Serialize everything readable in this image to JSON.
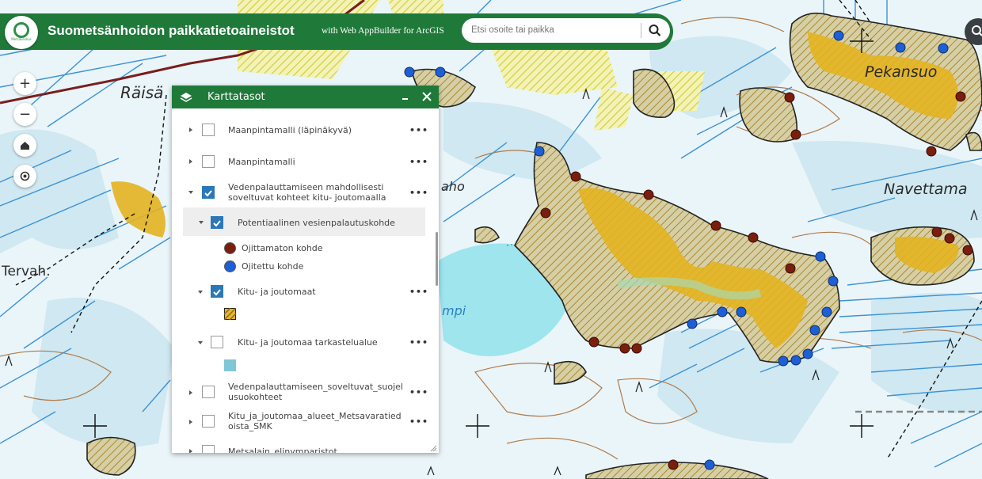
{
  "header": {
    "title": "Suometsänhoidon paikkatietoaineistot",
    "subtitle": "with Web AppBuilder for ArcGIS",
    "logo_text": "Metsäkeskus",
    "accent_color": "#1f7a3a"
  },
  "search": {
    "placeholder": "Etsi osoite tai paikka",
    "value": ""
  },
  "map_controls": {
    "zoom_in": "+",
    "zoom_out": "−",
    "home_icon": "home-icon",
    "locate_icon": "locate-icon"
  },
  "map_labels": [
    {
      "text": "Räisä"
    },
    {
      "text": "Pekansuo"
    },
    {
      "text": "Navettama"
    },
    {
      "text": "aho"
    },
    {
      "text": "Tervah."
    },
    {
      "text": "mpi"
    }
  ],
  "layer_panel": {
    "title": "Karttatasot",
    "layers": [
      {
        "label": "Maanpintamalli (läpinäkyvä)",
        "checked": false,
        "expanded": false
      },
      {
        "label": "Maanpintamalli",
        "checked": false,
        "expanded": false
      },
      {
        "label": "Vedenpalauttamiseen mahdollisesti soveltuvat kohteet kitu- joutomaalla",
        "checked": true,
        "expanded": true
      },
      {
        "label": "Potentiaalinen vesienpalautuskohde",
        "checked": true,
        "expanded": true
      },
      {
        "label": "Kitu- ja joutomaat",
        "checked": true,
        "expanded": true
      },
      {
        "label": "Kitu- ja joutomaa tarkastelualue",
        "checked": false,
        "expanded": true
      },
      {
        "label": "Vedenpalauttamiseen_soveltuvat_suojelusuokohteet",
        "checked": false,
        "expanded": false
      },
      {
        "label": "Kitu_ja_joutomaa_alueet_Metsavaratiedoista_SMK",
        "checked": false,
        "expanded": false
      },
      {
        "label": "Metsalain_elinymparistot",
        "checked": false,
        "expanded": false
      }
    ],
    "legend": [
      {
        "label": "Ojittamaton kohde",
        "color": "#7a1e0e"
      },
      {
        "label": "Ojitettu kohde",
        "color": "#1e5fd6"
      }
    ],
    "swatch_colors": {
      "kitu": "#e8b52a",
      "tarkastelu": "#7fc6d6"
    },
    "more_label": "•••"
  }
}
